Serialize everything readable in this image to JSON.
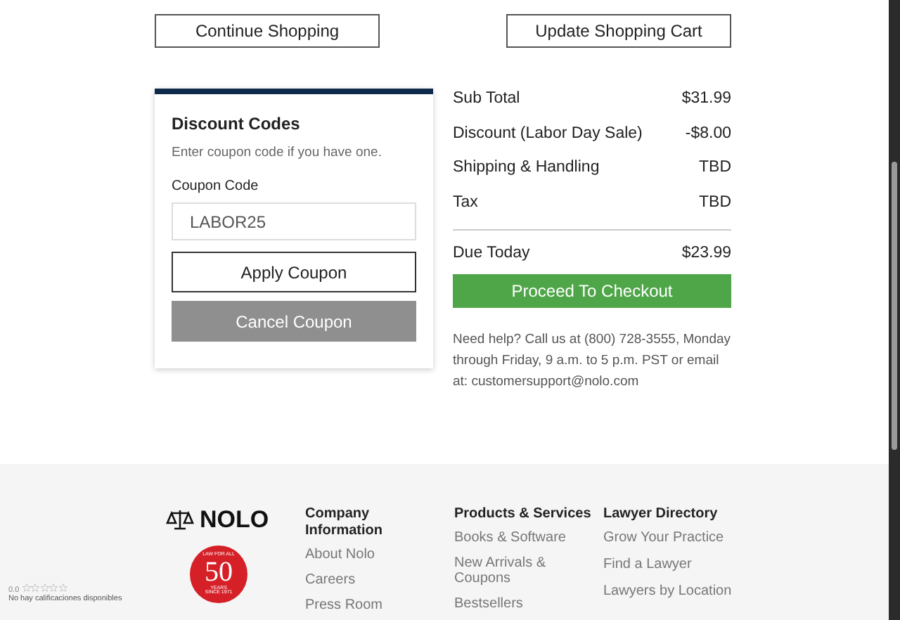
{
  "cart_actions": [
    "Continue Shopping",
    "Update Shopping Cart"
  ],
  "discount": {
    "title": "Discount Codes",
    "hint": "Enter coupon code if you have one.",
    "field_label": "Coupon Code",
    "field_value": "LABOR25",
    "buttons": [
      {
        "label": "Apply Coupon",
        "kind": "outline"
      },
      {
        "label": "Cancel Coupon",
        "kind": "muted"
      }
    ]
  },
  "summary": {
    "rows": [
      {
        "label": "Sub Total",
        "value": "$31.99"
      },
      {
        "label": "Discount (Labor Day Sale)",
        "value": "-$8.00"
      },
      {
        "label": "Shipping & Handling",
        "value": "TBD"
      },
      {
        "label": "Tax",
        "value": "TBD"
      }
    ],
    "total": {
      "label": "Due Today",
      "value": "$23.99"
    },
    "checkout": "Proceed To Checkout",
    "help": "Need help? Call us at (800) 728-3555, Monday through Friday, 9 a.m. to 5 p.m. PST or email at: customersupport@nolo.com"
  },
  "footer": {
    "logo": "NOLO",
    "badge": {
      "top": "LAW FOR ALL",
      "number": "50",
      "middle": "YEARS",
      "bottom": "SINCE 1971"
    },
    "columns": [
      {
        "heading": "Company Information",
        "links": [
          "About Nolo",
          "Careers",
          "Press Room"
        ]
      },
      {
        "heading": "Products & Services",
        "links": [
          "Books & Software",
          "New Arrivals & Coupons",
          "Bestsellers"
        ]
      },
      {
        "heading": "Lawyer Directory",
        "links": [
          "Grow Your Practice",
          "Find a Lawyer",
          "Lawyers by Location"
        ]
      }
    ],
    "rating": {
      "score": "0.0",
      "stars": 0,
      "text": "No hay calificaciones disponibles"
    }
  }
}
